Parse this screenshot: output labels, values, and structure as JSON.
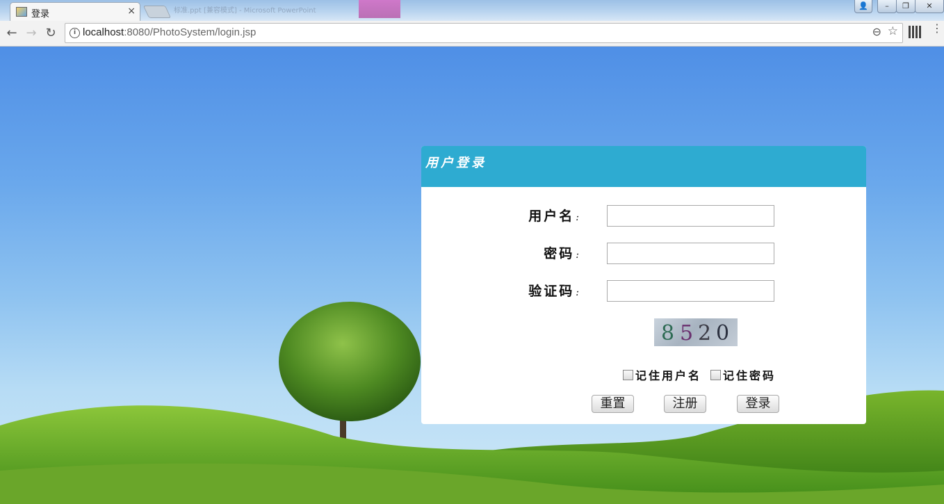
{
  "browser": {
    "tab_title": "登录",
    "tab_close": "×",
    "background_window_text": "标准.ppt [兼容模式] - Microsoft PowerPoint",
    "url_host": "localhost",
    "url_path": ":8080/PhotoSystem/login.jsp"
  },
  "icons": {
    "back": "←",
    "forward": "→",
    "reload": "↻",
    "info": "i",
    "zoom": "⊖",
    "bookmark": "☆",
    "menu": "⋮",
    "window_min": "–",
    "window_max": "❐",
    "window_close": "✕"
  },
  "login": {
    "header_title": "用户登录",
    "username_label": "用户名",
    "password_label": "密码",
    "captcha_label": "验证码",
    "label_colon": ":",
    "captcha_digits": [
      "8",
      "5",
      "2",
      "0"
    ],
    "remember_username": "记住用户名",
    "remember_password": "记住密码",
    "reset_button": "重置",
    "register_button": "注册",
    "login_button": "登录"
  },
  "colors": {
    "panel_header": "#2eabd1",
    "sky_top": "#4f8fe6",
    "grass": "#5a9a1e"
  }
}
